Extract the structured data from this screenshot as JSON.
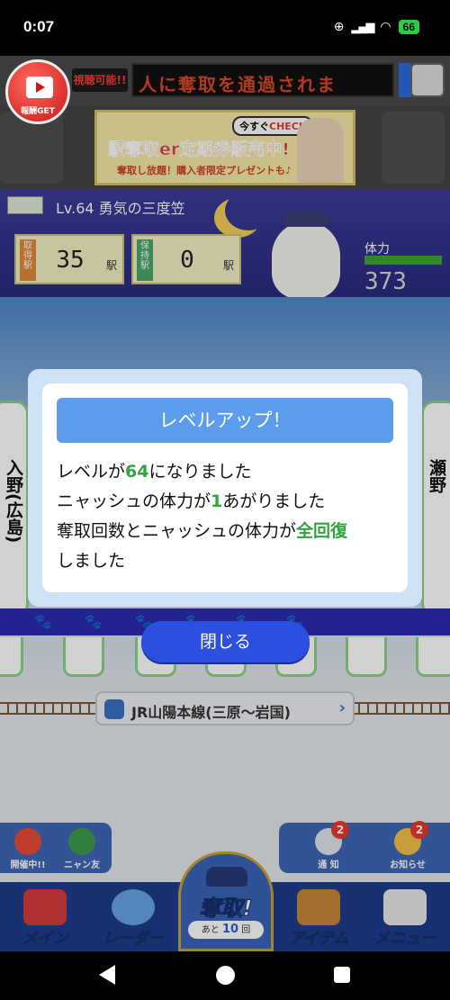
{
  "status_bar": {
    "time": "0:07",
    "battery": "66"
  },
  "topbar": {
    "video_label": "報酬GET",
    "available_label": "視聴可能!!",
    "ticker_text": "人に奪取を通過されま"
  },
  "banner": {
    "check_prefix": "今すぐ",
    "check_label": "CHECK",
    "headline": "駅奪取er定期券販売中!",
    "subline": "奪取し放題！購入者限定プレゼントも♪"
  },
  "player": {
    "level_title": "Lv.64 勇気の三度笠",
    "taken_tag": "取得駅",
    "taken_count": "35",
    "taken_unit": "駅",
    "held_tag": "保持駅",
    "held_count": "0",
    "held_unit": "駅",
    "stamina_label": "体力",
    "stamina_value": "373"
  },
  "board": {
    "left_station": "入野(広島)",
    "right_station": "瀬野",
    "line_name": "JR山陽本線(三原〜岩国)",
    "paws": "🐾🐾🐾🐾🐾🐾"
  },
  "modal": {
    "title": "レベルアップ！",
    "line1_pre": "レベルが",
    "line1_num": "64",
    "line1_post": "になりました",
    "line2_pre": "ニャッシュの体力が",
    "line2_num": "1",
    "line2_post": "あがりました",
    "line3_pre": "奪取回数とニャッシュの体力が",
    "line3_hl": "全回復",
    "line4": "しました",
    "close_label": "閉じる"
  },
  "side_buttons": {
    "event_label": "開催中!!",
    "friends_label": "ニャン友",
    "notify_label": "通 知",
    "notify_badge": "2",
    "news_label": "お知らせ",
    "news_badge": "2"
  },
  "bottom_nav": {
    "main_label": "メイン",
    "radar_label": "レーダー",
    "dattori_label": "奪取!",
    "remain_pre": "あと",
    "remain_num": "10",
    "remain_post": "回",
    "item_label": "アイテム",
    "menu_label": "メニュー"
  }
}
